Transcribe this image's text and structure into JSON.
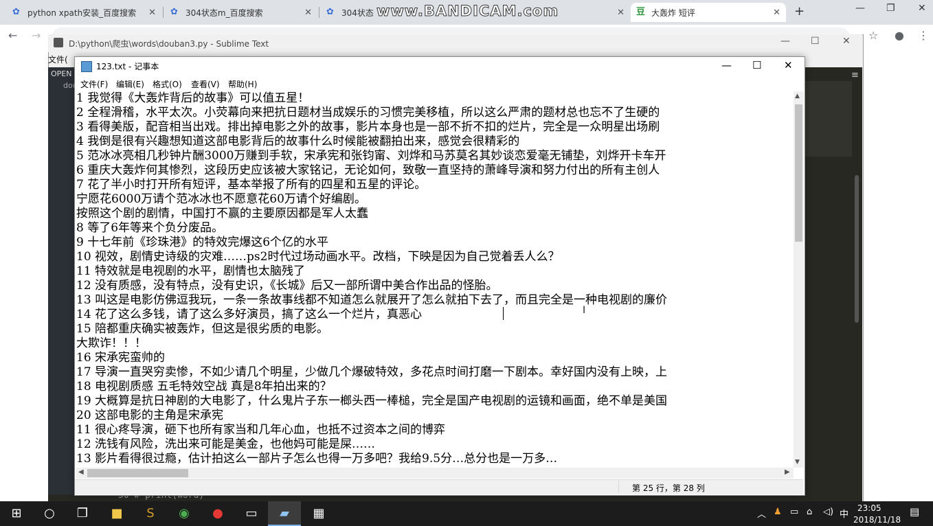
{
  "browser": {
    "tabs": [
      {
        "title": "python xpath安装_百度搜索",
        "icon": "paw-icon"
      },
      {
        "title": "304状态m_百度搜索",
        "icon": "paw-icon"
      },
      {
        "title": "304状态",
        "icon": "paw-icon"
      },
      {
        "title": "大轰炸 短评",
        "icon": "douban-icon"
      }
    ],
    "new_tab": "+",
    "window_controls": {
      "minimize": "—",
      "maximize": "❐",
      "close": "✕"
    }
  },
  "watermark": "www.BANDICAM.com",
  "sublime": {
    "title": "D:\\python\\爬虫\\words\\douban3.py - Sublime Text",
    "menu_first": "文件(",
    "sidebar_header": "OPEN",
    "sidebar_item": "dou",
    "code_line": "50  #     print(word)"
  },
  "notepad": {
    "title": "123.txt - 记事本",
    "menu": [
      "文件(F)",
      "编辑(E)",
      "格式(O)",
      "查看(V)",
      "帮助(H)"
    ],
    "lines": [
      "1 我觉得《大轰炸背后的故事》可以值五星！",
      "2 全程滑稽，水平太次。小荧幕向来把抗日题材当成娱乐的习惯完美移植，所以这么严肃的题材总也忘不了生硬的",
      "3 看得美版，配音相当出戏。排出掉电影之外的故事，影片本身也是一部不折不扣的烂片，完全是一众明星出场刷",
      "4 我倒是很有兴趣想知道这部电影背后的故事什么时候能被翻拍出来，感觉会很精彩的",
      "5 范冰冰亮相几秒钟片酬3000万赚到手软，宋承宪和张钧甯、刘烨和马苏莫名其妙谈恋爱毫无铺垫，刘烨开卡车开",
      "6 重庆大轰炸何其惨烈，这段历史应该被大家铭记，无论如何，致敬一直坚持的萧峰导演和努力付出的所有主创人",
      "7 花了半小时打开所有短评，基本举报了所有的四星和五星的评论。",
      "宁愿花6000万请个范冰冰也不愿意花60万请个好编剧。",
      "按照这个剧的剧情，中国打不赢的主要原因都是军人太蠢",
      "8 等了6年等来个负分废品。",
      "9 十七年前《珍珠港》的特效完爆这6个亿的水平",
      "10 视效，剧情史诗级的灾难……ps2时代过场动画水平。改档，下映是因为自己觉着丢人么？",
      "11 特效就是电视剧的水平，剧情也太脑残了",
      "12 没有质感，没有特点，没有史识，《长城》后又一部所谓中美合作出品的怪胎。",
      "13 叫这是电影仿佛逗我玩，一条一条故事线都不知道怎么就展开了怎么就拍下去了，而且完全是一种电视剧的廉价",
      "14 花了这么多钱，请了这么多好演员，搞了这么一个烂片，真恶心",
      "15 陪都重庆确实被轰炸，但这是很劣质的电影。",
      "大欺诈！！！",
      "16 宋承宪蛮帅的",
      "17 导演一直哭穷卖惨，不如少请几个明星，少做几个爆破特效，多花点时间打磨一下剧本。幸好国内没有上映，上",
      "18 电视剧质感 五毛特效空战 真是8年拍出来的？",
      "19 大概算是抗日神剧的大电影了，什么鬼片子东一榔头西一棒槌，完全是国产电视剧的运镜和画面，绝不单是美国",
      "20 这部电影的主角是宋承宪",
      "11 很心疼导演，砸下也所有家当和几年心血，也抵不过资本之间的博弈",
      "12 洗钱有风险，洗出来可能是美金，也他妈可能是屎……",
      "13 影片看得很过瘾，估计拍这么一部片子怎么也得一万多吧？我给9.5分…总分也是一万多…"
    ],
    "status": "第 25 行，第 28 列"
  },
  "taskbar": {
    "time": "23:05",
    "date": "2018/11/18",
    "ime": "中"
  }
}
